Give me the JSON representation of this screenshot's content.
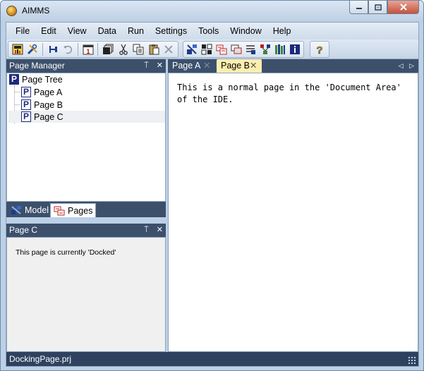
{
  "window": {
    "title": "AIMMS",
    "minimize_icon": "minimize-icon",
    "maximize_icon": "maximize-icon",
    "close_icon": "close-icon"
  },
  "menu": [
    "File",
    "Edit",
    "View",
    "Data",
    "Run",
    "Settings",
    "Tools",
    "Window",
    "Help"
  ],
  "toolbar": {
    "icons": [
      "user-icon",
      "tools-icon",
      "pin-icon",
      "undo-icon",
      "calendar-icon",
      "copy-pages-icon",
      "cut-icon",
      "copy-icon",
      "paste-icon",
      "delete-icon",
      "model-explorer-icon",
      "identifier-selector-icon",
      "page-manager-icon",
      "template-manager-icon",
      "menu-builder-icon",
      "data-manager-icon",
      "library-manager-icon",
      "info-icon",
      "help-icon"
    ],
    "calendar_day": "1"
  },
  "page_manager": {
    "title": "Page Manager",
    "pin_glyph": "⍑",
    "close_glyph": "✕",
    "root": {
      "icon_letter": "P",
      "label": "Page Tree"
    },
    "pages": [
      {
        "icon_letter": "P",
        "label": "Page A"
      },
      {
        "icon_letter": "P",
        "label": "Page B"
      },
      {
        "icon_letter": "P",
        "label": "Page C"
      }
    ],
    "tabs": {
      "model": "Model",
      "pages": "Pages"
    }
  },
  "docked_panel": {
    "title": "Page C",
    "pin_glyph": "⍑",
    "close_glyph": "✕",
    "text": "This page is currently 'Docked'"
  },
  "document": {
    "tabs": [
      {
        "label": "Page A",
        "close": "✕"
      },
      {
        "label": "Page B",
        "close": "✕"
      }
    ],
    "nav_prev": "◁",
    "nav_next": "▷",
    "line1": "This is a normal page in the 'Document Area'",
    "line2": "of the IDE."
  },
  "status": {
    "text": "DockingPage.prj"
  }
}
